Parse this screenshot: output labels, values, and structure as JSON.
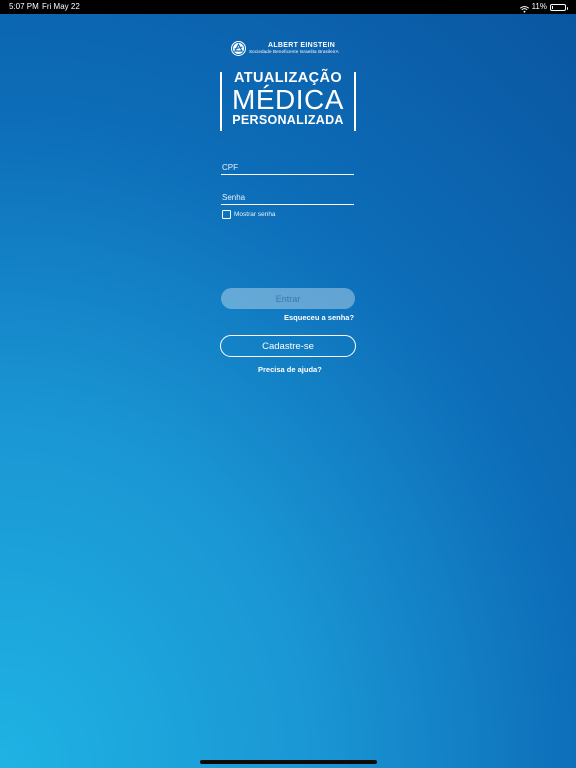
{
  "status_bar": {
    "time": "5:07 PM",
    "date": "Fri May 22",
    "battery_text": "11%",
    "battery_level": 0.11
  },
  "brand": {
    "name": "ALBERT EINSTEIN",
    "subtitle": "Sociedade Beneficente Israelita BrasileirA"
  },
  "title": {
    "line1": "ATUALIZAÇÃO",
    "line2": "MÉDICA",
    "line3": "PERSONALIZADA"
  },
  "form": {
    "cpf_placeholder": "CPF",
    "senha_placeholder": "Senha",
    "show_password_label": "Mostrar senha",
    "enter_label": "Entrar",
    "forgot_label": "Esqueceu a senha?",
    "register_label": "Cadastre-se",
    "help_label": "Precisa de ajuda?"
  },
  "colors": {
    "background_light": "#1fb3e3",
    "background_dark": "#0a55a0",
    "text": "#ffffff"
  },
  "icons": {
    "wifi": "wifi-icon",
    "battery": "battery-icon",
    "logo": "einstein-logo-icon"
  }
}
